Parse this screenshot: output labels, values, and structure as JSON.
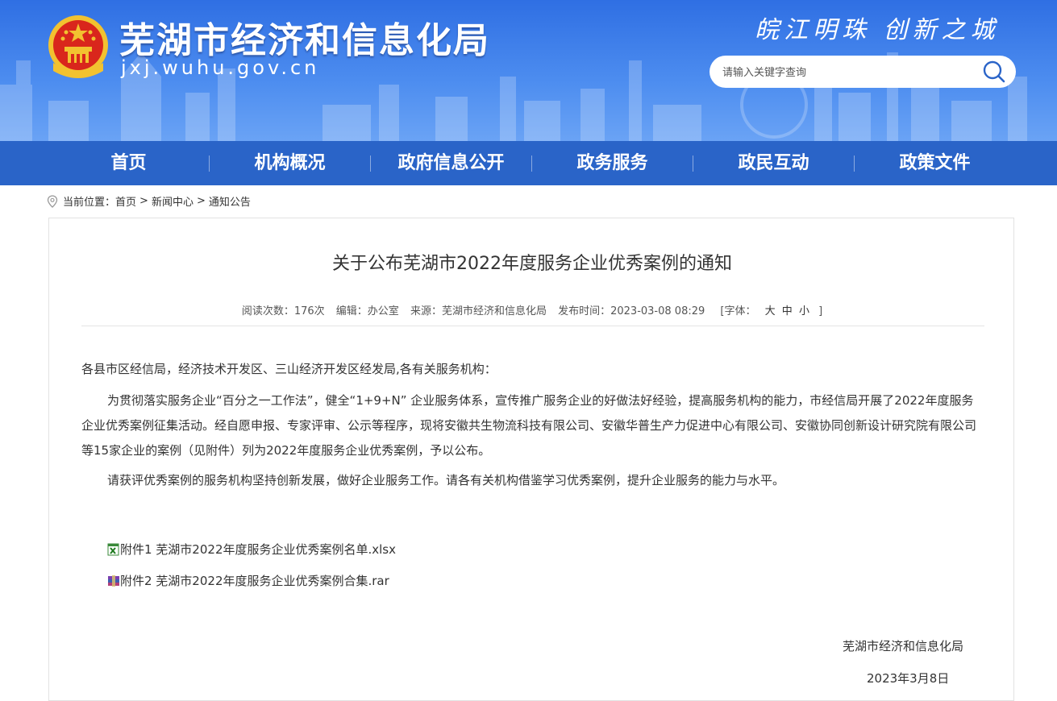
{
  "header": {
    "site_title": "芜湖市经济和信息化局",
    "site_url": "jxj.wuhu.gov.cn",
    "slogan": "皖江明珠  创新之城",
    "search_placeholder": "请输入关键字查询"
  },
  "nav": [
    "首页",
    "机构概况",
    "政府信息公开",
    "政务服务",
    "政民互动",
    "政策文件"
  ],
  "breadcrumb": {
    "prefix": "当前位置：",
    "items": [
      "首页",
      "新闻中心",
      "通知公告"
    ],
    "sep": ">"
  },
  "article": {
    "title": "关于公布芜湖市2022年度服务企业优秀案例的通知",
    "meta": {
      "views": "阅读次数：176次",
      "editor": "编辑：办公室",
      "source": "来源：芜湖市经济和信息化局",
      "date": "发布时间：2023-03-08 08:29",
      "font_label": "[字体：",
      "font_large": "大",
      "font_medium": "中",
      "font_small": "小",
      "font_end": "]"
    },
    "greeting": "各县市区经信局，经济技术开发区、三山经济开发区经发局,各有关服务机构：",
    "para1": "为贯彻落实服务企业“百分之一工作法”，健全“1+9+N” 企业服务体系，宣传推广服务企业的好做法好经验，提高服务机构的能力，市经信局开展了2022年度服务企业优秀案例征集活动。经自愿申报、专家评审、公示等程序，现将安徽共生物流科技有限公司、安徽华普生产力促进中心有限公司、安徽协同创新设计研究院有限公司等15家企业的案例（见附件）列为2022年度服务企业优秀案例，予以公布。",
    "para2": "请获评优秀案例的服务机构坚持创新发展，做好企业服务工作。请各有关机构借鉴学习优秀案例，提升企业服务的能力与水平。",
    "attachments": [
      {
        "label": "附件1 芜湖市2022年度服务企业优秀案例名单.xlsx",
        "icon": "excel-file-icon"
      },
      {
        "label": "附件2 芜湖市2022年度服务企业优秀案例合集.rar",
        "icon": "rar-archive-icon"
      }
    ],
    "signature": "芜湖市经济和信息化局",
    "sign_date": "2023年3月8日"
  }
}
